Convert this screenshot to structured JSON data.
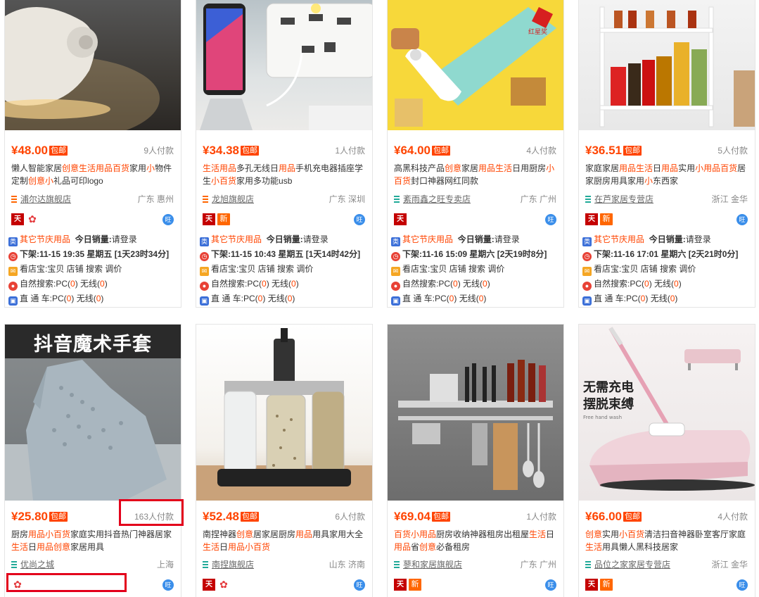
{
  "products": [
    {
      "price": "¥48.00",
      "baoyou": "包邮",
      "paid": "9人付款",
      "title_parts": [
        [
          "懒人智能家居",
          0
        ],
        [
          "创意生活用品百货",
          1
        ],
        [
          "家用",
          0
        ],
        [
          "小",
          1
        ],
        [
          "物件定制",
          0
        ],
        [
          "创意小",
          1
        ],
        [
          "礼品可印logo",
          0
        ]
      ],
      "shop": "浦尔达旗舰店",
      "shop_icon": "orange",
      "location": "广东 惠州",
      "badges": [
        "tmall",
        "flower"
      ],
      "category": "其它节庆用品",
      "sales_label": "今日销量:",
      "sales_value": "请登录",
      "delist": "下架:11-15 19:35 星期五 [1天23时34分]",
      "kdb": "看店宝:宝贝 店铺 搜索 调价",
      "natural": [
        "自然搜索:PC(",
        "0",
        ") 无线(",
        "0",
        ")"
      ],
      "ztc": [
        "直 通 车:PC(",
        "0",
        ") 无线(",
        "0",
        ")"
      ]
    },
    {
      "price": "¥34.38",
      "baoyou": "包邮",
      "paid": "1人付款",
      "title_parts": [
        [
          "生活用品",
          1
        ],
        [
          "多孔无线日",
          0
        ],
        [
          "用品",
          1
        ],
        [
          "手机充电器插座学生",
          0
        ],
        [
          "小百货",
          1
        ],
        [
          "家用多功能usb",
          0
        ]
      ],
      "shop": "龙旭旗舰店",
      "shop_icon": "orange",
      "location": "广东 深圳",
      "badges": [
        "tmall",
        "new"
      ],
      "category": "其它节庆用品",
      "sales_label": "今日销量:",
      "sales_value": "请登录",
      "delist": "下架:11-15 10:43 星期五 [1天14时42分]",
      "kdb": "看店宝:宝贝 店铺 搜索 调价",
      "natural": [
        "自然搜索:PC(",
        "0",
        ") 无线(",
        "0",
        ")"
      ],
      "ztc": [
        "直 通 车:PC(",
        "0",
        ") 无线(",
        "0",
        ")"
      ]
    },
    {
      "price": "¥64.00",
      "baoyou": "包邮",
      "paid": "4人付款",
      "title_parts": [
        [
          "高黑科技产品",
          0
        ],
        [
          "创意",
          1
        ],
        [
          "家居",
          0
        ],
        [
          "用品生活",
          1
        ],
        [
          "日用厨房",
          0
        ],
        [
          "小百货",
          1
        ],
        [
          "封口神器网红同款",
          0
        ]
      ],
      "shop": "紊雨鑫之旺专卖店",
      "shop_icon": "green",
      "location": "广东 广州",
      "badges": [
        "tmall"
      ],
      "category": "其它节庆用品",
      "sales_label": "今日销量:",
      "sales_value": "请登录",
      "delist": "下架:11-16 15:09 星期六 [2天19时8分]",
      "kdb": "看店宝:宝贝 店铺 搜索 调价",
      "natural": [
        "自然搜索:PC(",
        "0",
        ") 无线(",
        "0",
        ")"
      ],
      "ztc": [
        "直 通 车:PC(",
        "0",
        ") 无线(",
        "0",
        ")"
      ]
    },
    {
      "price": "¥36.51",
      "baoyou": "包邮",
      "paid": "5人付款",
      "title_parts": [
        [
          "家庭家居",
          0
        ],
        [
          "用品生活",
          1
        ],
        [
          "日",
          0
        ],
        [
          "用品",
          1
        ],
        [
          "实用",
          0
        ],
        [
          "小用品百货",
          1
        ],
        [
          "居家厨房用具家用",
          0
        ],
        [
          "小",
          1
        ],
        [
          "东西家",
          0
        ]
      ],
      "shop": "在芦家居专营店",
      "shop_icon": "green",
      "location": "浙江 金华",
      "badges": [
        "tmall",
        "new"
      ],
      "category": "其它节庆用品",
      "sales_label": "今日销量:",
      "sales_value": "请登录",
      "delist": "下架:11-16 17:01 星期六 [2天21时0分]",
      "kdb": "看店宝:宝贝 店铺 搜索 调价",
      "natural": [
        "自然搜索:PC(",
        "0",
        ") 无线(",
        "0",
        ")"
      ],
      "ztc": [
        "直 通 车:PC(",
        "0",
        ") 无线(",
        "0",
        ")"
      ]
    },
    {
      "price": "¥25.80",
      "baoyou": "包邮",
      "paid": "163人付款",
      "image_text": "抖音魔术手套",
      "title_parts": [
        [
          "厨房",
          0
        ],
        [
          "用品小百货",
          1
        ],
        [
          "家庭实用抖音热门神器居家",
          0
        ],
        [
          "生活",
          1
        ],
        [
          "日",
          0
        ],
        [
          "用品创意",
          1
        ],
        [
          "家居用具",
          0
        ]
      ],
      "shop": "优尚之城",
      "shop_icon": "green",
      "location": "上海",
      "badges": [
        "flower"
      ]
    },
    {
      "price": "¥52.48",
      "baoyou": "包邮",
      "paid": "6人付款",
      "title_parts": [
        [
          "南捏神器",
          0
        ],
        [
          "创意",
          1
        ],
        [
          "居家居厨房",
          0
        ],
        [
          "用品",
          1
        ],
        [
          "用具家用大全",
          0
        ],
        [
          "生活",
          1
        ],
        [
          "日",
          0
        ],
        [
          "用品小百货",
          1
        ]
      ],
      "shop": "南捏旗舰店",
      "shop_icon": "green",
      "location": "山东 济南",
      "badges": [
        "tmall",
        "flower"
      ]
    },
    {
      "price": "¥69.04",
      "baoyou": "包邮",
      "paid": "1人付款",
      "title_parts": [
        [
          "百货小用品",
          1
        ],
        [
          "厨房收纳神器租房出租屋",
          0
        ],
        [
          "生活",
          1
        ],
        [
          "日",
          0
        ],
        [
          "用品",
          1
        ],
        [
          "省",
          0
        ],
        [
          "创意",
          1
        ],
        [
          "必备租房",
          0
        ]
      ],
      "shop": "蓼和家居旗舰店",
      "shop_icon": "green",
      "location": "广东 广州",
      "badges": [
        "tmall",
        "new"
      ]
    },
    {
      "price": "¥66.00",
      "baoyou": "包邮",
      "paid": "4人付款",
      "image_text": [
        "无需充电",
        "摆脱束缚",
        "Free hand wash"
      ],
      "title_parts": [
        [
          "创意",
          1
        ],
        [
          "实用",
          0
        ],
        [
          "小百货",
          1
        ],
        [
          "清洁扫音神器卧室客厅家庭",
          0
        ],
        [
          "生活",
          1
        ],
        [
          "用具懒人黑科技居家",
          0
        ]
      ],
      "shop": "品位之家家居专营店",
      "shop_icon": "green",
      "location": "浙江 金华",
      "badges": [
        "tmall",
        "new"
      ]
    }
  ],
  "badge_text": {
    "tmall": "天",
    "new": "新",
    "flower": "✿",
    "wang": "旺"
  },
  "colors": {
    "price": "#ff4400",
    "highlight_box": "#e3001b",
    "accent_blue": "#3b6fd8"
  }
}
